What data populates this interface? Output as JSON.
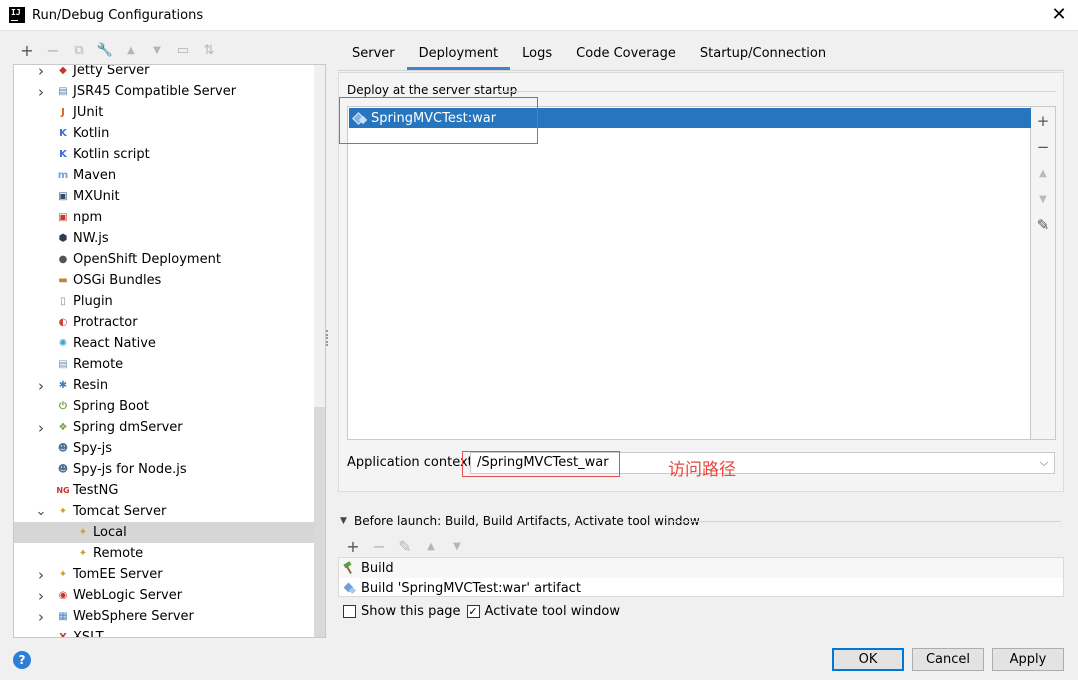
{
  "window": {
    "title": "Run/Debug Configurations",
    "close_glyph": "✕"
  },
  "left_toolbar": [
    {
      "icon": "plus-icon",
      "glyph": "+",
      "enabled": true
    },
    {
      "icon": "minus-icon",
      "glyph": "−",
      "enabled": false
    },
    {
      "icon": "copy-icon",
      "glyph": "⧉",
      "enabled": false
    },
    {
      "icon": "wrench-icon",
      "glyph": "🔧",
      "enabled": true
    },
    {
      "icon": "move-up-icon",
      "glyph": "▲",
      "enabled": false
    },
    {
      "icon": "move-down-icon",
      "glyph": "▼",
      "enabled": false
    },
    {
      "icon": "folder-icon",
      "glyph": "▭",
      "enabled": false
    },
    {
      "icon": "sort-icon",
      "glyph": "⇅",
      "enabled": false
    }
  ],
  "tree": {
    "items": [
      {
        "label": "Jetty Server",
        "icon": "jetty-icon",
        "glyph": "◆",
        "color": "#c0392b",
        "expandable": true,
        "indent": 1
      },
      {
        "label": "JSR45 Compatible Server",
        "icon": "jsr45-icon",
        "glyph": "▤",
        "color": "#5a7fa5",
        "expandable": true,
        "indent": 1
      },
      {
        "label": "JUnit",
        "icon": "junit-icon",
        "glyph": "J",
        "color": "#d1681b",
        "expandable": false,
        "indent": 1
      },
      {
        "label": "Kotlin",
        "icon": "kotlin-icon",
        "glyph": "K",
        "color": "#3a6fd6",
        "expandable": false,
        "indent": 1
      },
      {
        "label": "Kotlin script",
        "icon": "kotlin-script-icon",
        "glyph": "K",
        "color": "#3a6fd6",
        "expandable": false,
        "indent": 1
      },
      {
        "label": "Maven",
        "icon": "maven-icon",
        "glyph": "m",
        "color": "#6fa3d6",
        "expandable": false,
        "indent": 1
      },
      {
        "label": "MXUnit",
        "icon": "mxunit-icon",
        "glyph": "▣",
        "color": "#324b6e",
        "expandable": false,
        "indent": 1
      },
      {
        "label": "npm",
        "icon": "npm-icon",
        "glyph": "▣",
        "color": "#c0392b",
        "expandable": false,
        "indent": 1
      },
      {
        "label": "NW.js",
        "icon": "nwjs-icon",
        "glyph": "⬢",
        "color": "#2c3e50",
        "expandable": false,
        "indent": 1
      },
      {
        "label": "OpenShift Deployment",
        "icon": "openshift-icon",
        "glyph": "●",
        "color": "#555555",
        "expandable": false,
        "indent": 1
      },
      {
        "label": "OSGi Bundles",
        "icon": "osgi-icon",
        "glyph": "▬",
        "color": "#c5823a",
        "expandable": false,
        "indent": 1
      },
      {
        "label": "Plugin",
        "icon": "plugin-icon",
        "glyph": "▯",
        "color": "#8c8c8c",
        "expandable": false,
        "indent": 1
      },
      {
        "label": "Protractor",
        "icon": "protractor-icon",
        "glyph": "◐",
        "color": "#d0413a",
        "expandable": false,
        "indent": 1
      },
      {
        "label": "React Native",
        "icon": "react-native-icon",
        "glyph": "✺",
        "color": "#3aa5d6",
        "expandable": false,
        "indent": 1
      },
      {
        "label": "Remote",
        "icon": "remote-icon",
        "glyph": "▤",
        "color": "#6e8eab",
        "expandable": false,
        "indent": 1
      },
      {
        "label": "Resin",
        "icon": "resin-icon",
        "glyph": "✱",
        "color": "#3a7fbf",
        "expandable": true,
        "indent": 1
      },
      {
        "label": "Spring Boot",
        "icon": "spring-boot-icon",
        "glyph": "⏻",
        "color": "#6a9e3a",
        "expandable": false,
        "indent": 1
      },
      {
        "label": "Spring dmServer",
        "icon": "spring-dmserver-icon",
        "glyph": "❖",
        "color": "#6a9e3a",
        "expandable": true,
        "indent": 1
      },
      {
        "label": "Spy-js",
        "icon": "spy-js-icon",
        "glyph": "☻",
        "color": "#4f6f8f",
        "expandable": false,
        "indent": 1
      },
      {
        "label": "Spy-js for Node.js",
        "icon": "spy-js-node-icon",
        "glyph": "☻",
        "color": "#4f6f8f",
        "expandable": false,
        "indent": 1
      },
      {
        "label": "TestNG",
        "icon": "testng-icon",
        "glyph": "NG",
        "color": "#c0392b",
        "expandable": false,
        "indent": 1
      },
      {
        "label": "Tomcat Server",
        "icon": "tomcat-icon",
        "glyph": "✦",
        "color": "#c9a227",
        "expandable": true,
        "expanded": true,
        "indent": 1
      },
      {
        "label": "Local",
        "icon": "tomcat-local-icon",
        "glyph": "✦",
        "color": "#c9a227",
        "expandable": false,
        "indent": 2,
        "selected": true
      },
      {
        "label": "Remote",
        "icon": "tomcat-remote-icon",
        "glyph": "✦",
        "color": "#c9a227",
        "expandable": false,
        "indent": 2
      },
      {
        "label": "TomEE Server",
        "icon": "tomee-icon",
        "glyph": "✦",
        "color": "#c9a227",
        "expandable": true,
        "indent": 1
      },
      {
        "label": "WebLogic Server",
        "icon": "weblogic-icon",
        "glyph": "◉",
        "color": "#c0392b",
        "expandable": true,
        "indent": 1
      },
      {
        "label": "WebSphere Server",
        "icon": "websphere-icon",
        "glyph": "▦",
        "color": "#4a86c4",
        "expandable": true,
        "indent": 1
      },
      {
        "label": "XSLT",
        "icon": "xslt-icon",
        "glyph": "X",
        "color": "#c0392b",
        "expandable": false,
        "indent": 1
      }
    ]
  },
  "tabs": [
    {
      "label": "Server",
      "active": false
    },
    {
      "label": "Deployment",
      "active": true
    },
    {
      "label": "Logs",
      "active": false
    },
    {
      "label": "Code Coverage",
      "active": false
    },
    {
      "label": "Startup/Connection",
      "active": false
    }
  ],
  "deployment": {
    "section_title": "Deploy at the server startup",
    "artifacts": [
      {
        "label": "SpringMVCTest:war",
        "icon": "artifact-war-icon",
        "selected": true
      }
    ],
    "side_buttons": [
      {
        "icon": "plus-icon",
        "glyph": "+",
        "enabled": true
      },
      {
        "icon": "minus-icon",
        "glyph": "−",
        "enabled": true
      },
      {
        "icon": "move-up-icon",
        "glyph": "▲",
        "enabled": false
      },
      {
        "icon": "move-down-icon",
        "glyph": "▼",
        "enabled": false
      },
      {
        "icon": "edit-icon",
        "glyph": "✎",
        "enabled": true
      }
    ],
    "app_context_label": "Application context:",
    "app_context_value": "/SpringMVCTest_war",
    "annotation": "访问路径"
  },
  "before_launch": {
    "title": "Before launch: Build, Build Artifacts, Activate tool window",
    "toolbar": [
      {
        "icon": "plus-icon",
        "glyph": "+",
        "enabled": true
      },
      {
        "icon": "minus-icon",
        "glyph": "−",
        "enabled": false
      },
      {
        "icon": "edit-icon",
        "glyph": "✎",
        "enabled": false
      },
      {
        "icon": "move-up-icon",
        "glyph": "▲",
        "enabled": false
      },
      {
        "icon": "move-down-icon",
        "glyph": "▼",
        "enabled": false
      }
    ],
    "tasks": [
      {
        "label": "Build",
        "icon": "build-hammer-icon"
      },
      {
        "label": "Build 'SpringMVCTest:war' artifact",
        "icon": "artifact-war-icon"
      }
    ],
    "show_this_page_label": "Show this page",
    "show_this_page_checked": false,
    "activate_tool_window_label": "Activate tool window",
    "activate_tool_window_checked": true
  },
  "footer": {
    "help_glyph": "?",
    "ok_label": "OK",
    "cancel_label": "Cancel",
    "apply_label": "Apply"
  }
}
